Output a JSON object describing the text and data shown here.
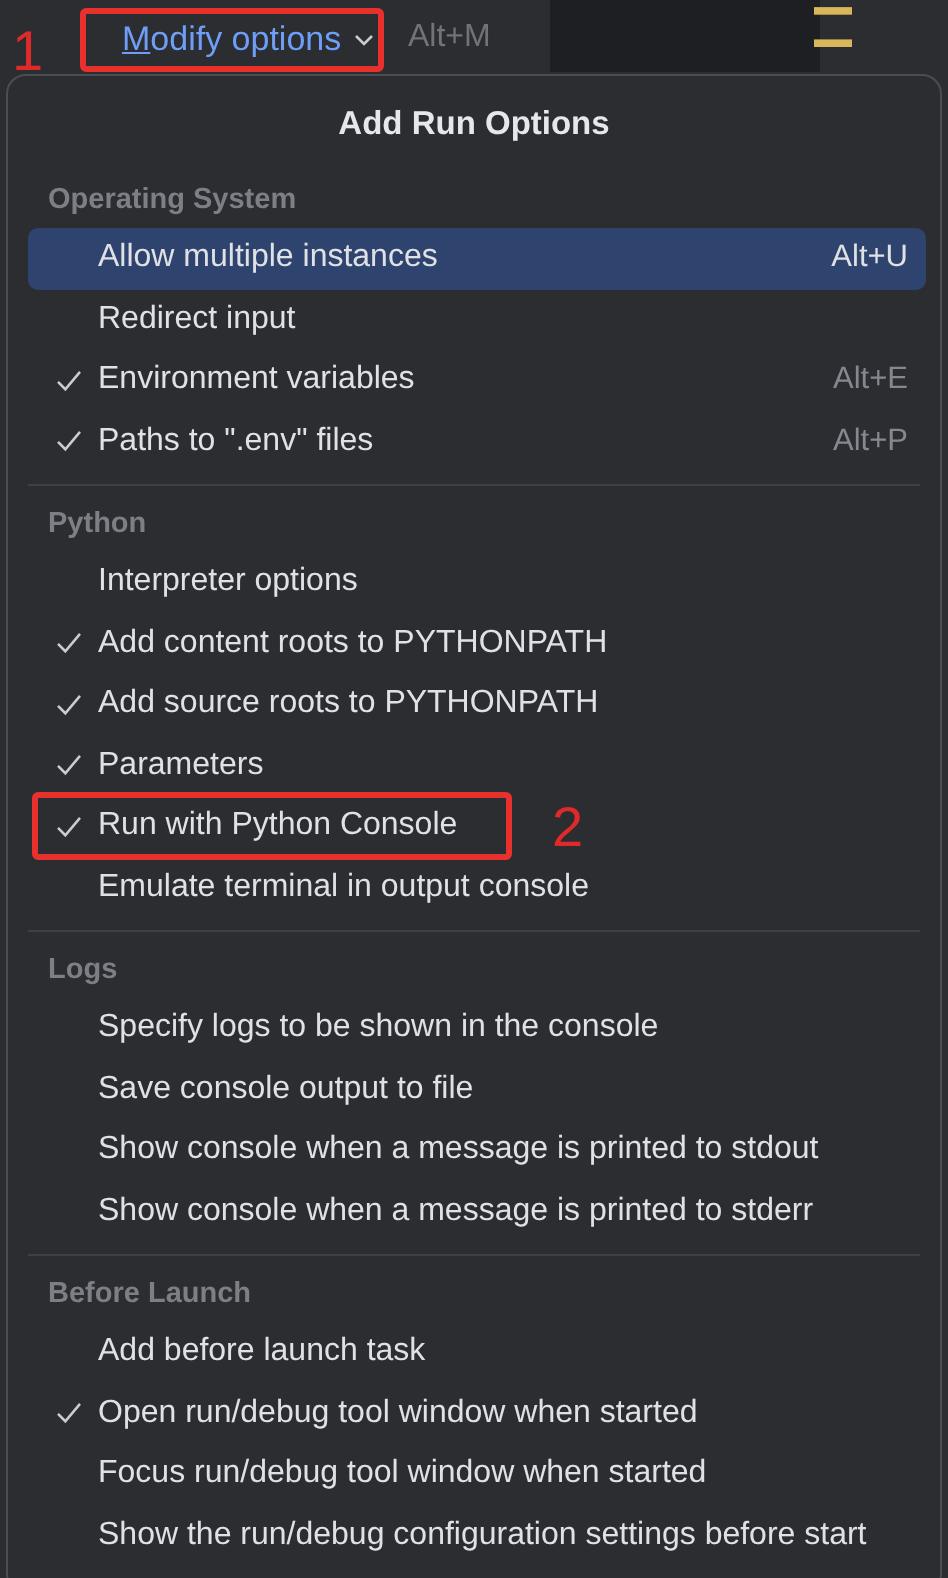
{
  "toolbar": {
    "link": {
      "label": "Modify options",
      "mnemonic": true,
      "annotation": "1"
    },
    "shortcut": "Alt+M"
  },
  "popup": {
    "title": "Add Run Options",
    "sections": [
      {
        "heading": "Operating System",
        "items": [
          {
            "label": "Allow multiple instances",
            "checked": false,
            "selected": true,
            "shortcut": "Alt+U"
          },
          {
            "label": "Redirect input",
            "checked": false,
            "selected": false
          },
          {
            "label": "Environment variables",
            "checked": true,
            "selected": false,
            "shortcut": "Alt+E"
          },
          {
            "label": "Paths to \".env\" files",
            "checked": true,
            "selected": false,
            "shortcut": "Alt+P"
          }
        ]
      },
      {
        "heading": "Python",
        "items": [
          {
            "label": "Interpreter options",
            "checked": false,
            "selected": false
          },
          {
            "label": "Add content roots to PYTHONPATH",
            "checked": true,
            "selected": false
          },
          {
            "label": "Add source roots to PYTHONPATH",
            "checked": true,
            "selected": false
          },
          {
            "label": "Parameters",
            "checked": true,
            "selected": false
          },
          {
            "label": "Run with Python Console",
            "checked": true,
            "selected": false,
            "annotation": "2"
          },
          {
            "label": "Emulate terminal in output console",
            "checked": false,
            "selected": false
          }
        ]
      },
      {
        "heading": "Logs",
        "items": [
          {
            "label": "Specify logs to be shown in the console",
            "checked": false,
            "selected": false
          },
          {
            "label": "Save console output to file",
            "checked": false,
            "selected": false
          },
          {
            "label": "Show console when a message is printed to stdout",
            "checked": false,
            "selected": false
          },
          {
            "label": "Show console when a message is printed to stderr",
            "checked": false,
            "selected": false
          }
        ]
      },
      {
        "heading": "Before Launch",
        "items": [
          {
            "label": "Add before launch task",
            "checked": false,
            "selected": false
          },
          {
            "label": "Open run/debug tool window when started",
            "checked": true,
            "selected": false
          },
          {
            "label": "Focus run/debug tool window when started",
            "checked": false,
            "selected": false
          },
          {
            "label": "Show the run/debug configuration settings before start",
            "checked": false,
            "selected": false
          }
        ]
      }
    ]
  }
}
